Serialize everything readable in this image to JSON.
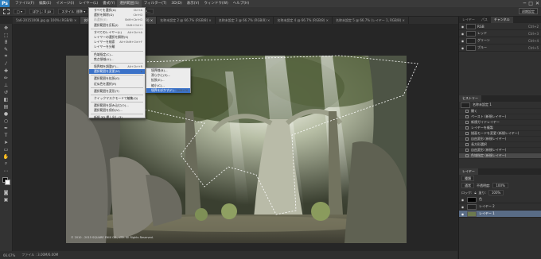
{
  "app": {
    "logo": "Ps",
    "menus": [
      "ファイル(F)",
      "編集(E)",
      "イメージ(I)",
      "レイヤー(L)",
      "書式(Y)",
      "選択範囲(S)",
      "フィルター(T)",
      "3D(D)",
      "表示(V)",
      "ウィンドウ(W)",
      "ヘルプ(H)"
    ],
    "active_menu": "選択範囲(S)",
    "window_controls": [
      "─",
      "□",
      "✕"
    ]
  },
  "options_bar": {
    "chips": [
      "□ ▾",
      "ぼかし: 0 px",
      "スタイル: 標準 ▾",
      "幅:",
      "高さ:",
      "境界線を調整..."
    ],
    "workspace": "初期設定"
  },
  "tabs": [
    {
      "label": "5a6-20151008.jpg @ 100% (RGB/8) ×",
      "active": false
    },
    {
      "label": "名称未設定 1 @ 66.7% (レイヤー 1, RGB/8) ×",
      "active": true
    },
    {
      "label": "名称未設定 2 @ 66.7% (RGB/8) ×",
      "active": false
    },
    {
      "label": "名称未設定 3 @ 66.7% (RGB/8) ×",
      "active": false
    },
    {
      "label": "名称未設定 4 @ 66.7% (RGB/8) ×",
      "active": false
    },
    {
      "label": "名称未設定 5 @ 66.7% (レイヤー 1, RGB/8) ×",
      "active": false
    }
  ],
  "menu": {
    "items": [
      {
        "label": "すべてを選択(A)",
        "shortcut": "Ctrl+A"
      },
      {
        "label": "選択を解除(D)",
        "shortcut": "Ctrl+D"
      },
      {
        "label": "再選択(E)",
        "shortcut": "Shift+Ctrl+D",
        "dim": true
      },
      {
        "label": "選択範囲を反転(I)",
        "shortcut": "Shift+Ctrl+I"
      },
      {
        "sep": true
      },
      {
        "label": "すべてのレイヤー(L)",
        "shortcut": "Alt+Ctrl+A"
      },
      {
        "label": "レイヤーの選択を解除(S)",
        "shortcut": ""
      },
      {
        "label": "レイヤーを検索",
        "shortcut": "Alt+Shift+Ctrl+F"
      },
      {
        "label": "レイヤーを分離",
        "shortcut": ""
      },
      {
        "sep": true
      },
      {
        "label": "色域指定(C)...",
        "shortcut": ""
      },
      {
        "label": "焦点領域(U)...",
        "shortcut": ""
      },
      {
        "sep": true
      },
      {
        "label": "境界線を調整(F)...",
        "shortcut": "Alt+Ctrl+R"
      },
      {
        "label": "選択範囲を変更(M)",
        "shortcut": "▸",
        "highlight": true
      },
      {
        "sep": true
      },
      {
        "label": "選択範囲を拡張(G)",
        "shortcut": ""
      },
      {
        "label": "近似色を選択(R)",
        "shortcut": ""
      },
      {
        "sep": true
      },
      {
        "label": "選択範囲を変形(T)",
        "shortcut": ""
      },
      {
        "sep": true
      },
      {
        "label": "クイックマスクモードで編集(Q)",
        "shortcut": ""
      },
      {
        "sep": true
      },
      {
        "label": "選択範囲を読み込む(O)...",
        "shortcut": ""
      },
      {
        "label": "選択範囲を保存(V)...",
        "shortcut": ""
      },
      {
        "sep": true
      },
      {
        "label": "新規 3D 押し出し(3)",
        "shortcut": ""
      }
    ]
  },
  "submenu": {
    "items": [
      {
        "label": "境界線(B)...",
        "shortcut": ""
      },
      {
        "label": "滑らかに(S)...",
        "shortcut": ""
      },
      {
        "label": "拡張(E)...",
        "shortcut": ""
      },
      {
        "label": "縮小(C)...",
        "shortcut": ""
      },
      {
        "label": "境界をぼかす(F)...",
        "shortcut": "Shift+F6",
        "highlight": true
      }
    ]
  },
  "channels_panel": {
    "tabs": [
      "レイヤー",
      "パス",
      "チャンネル"
    ],
    "active_tab": "チャンネル",
    "rows": [
      {
        "name": "RGB",
        "shortcut": "Ctrl+2"
      },
      {
        "name": "レッド",
        "shortcut": "Ctrl+3"
      },
      {
        "name": "グリーン",
        "shortcut": "Ctrl+4"
      },
      {
        "name": "ブルー",
        "shortcut": "Ctrl+5"
      }
    ]
  },
  "history_panel": {
    "title": "ヒストリー",
    "snapshot": "名称未設定 1",
    "items": [
      "開く",
      "ペースト (新規レイヤー)",
      "新規ガイドレイヤー",
      "レイヤーを複製",
      "描画モードを変更 (新規レイヤー)",
      "自由変形 (新規レイヤー)",
      "長方形選択",
      "自由変形 (新規レイヤー)",
      "色域指定 (新規レイヤー)"
    ]
  },
  "layers_panel": {
    "title": "レイヤー",
    "kind": "種類",
    "mode": "通常",
    "opacity_label": "不透明度:",
    "opacity": "100%",
    "lock_label": "ロック:",
    "fill_label": "塗り:",
    "fill": "100%",
    "layers": [
      {
        "name": "色",
        "selected": false
      },
      {
        "name": "レイヤー 2",
        "selected": false
      },
      {
        "name": "レイヤー 1",
        "selected": true
      }
    ]
  },
  "status": {
    "zoom": "66.67%",
    "doc": "ファイル : 3.00M/6.00M"
  },
  "photo": {
    "copyright": "© 2010 - 2015 SQUARE ENIX CO., LTD. All Rights Reserved."
  }
}
